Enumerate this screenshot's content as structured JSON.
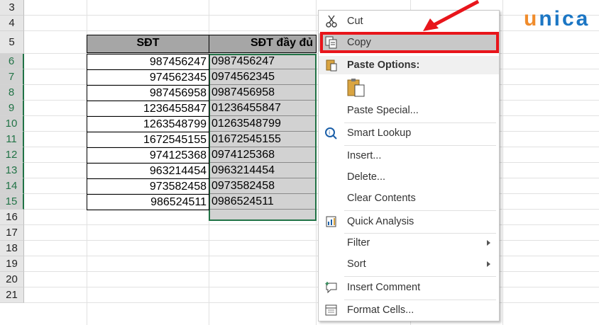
{
  "sheet": {
    "rows": [
      {
        "num": "3"
      },
      {
        "num": "4"
      },
      {
        "num": "5"
      },
      {
        "num": "6"
      },
      {
        "num": "7"
      },
      {
        "num": "8"
      },
      {
        "num": "9"
      },
      {
        "num": "10"
      },
      {
        "num": "11"
      },
      {
        "num": "12"
      },
      {
        "num": "13"
      },
      {
        "num": "14"
      },
      {
        "num": "15"
      },
      {
        "num": "16"
      },
      {
        "num": "17"
      },
      {
        "num": "18"
      },
      {
        "num": "19"
      },
      {
        "num": "20"
      },
      {
        "num": "21"
      }
    ],
    "table": {
      "headers": [
        "SĐT",
        "SĐT đầy đủ"
      ],
      "data": [
        [
          "987456247",
          "0987456247"
        ],
        [
          "974562345",
          "0974562345"
        ],
        [
          "987456958",
          "0987456958"
        ],
        [
          "1236455847",
          "01236455847"
        ],
        [
          "1263548799",
          "01263548799"
        ],
        [
          "1672545155",
          "01672545155"
        ],
        [
          "974125368",
          "0974125368"
        ],
        [
          "963214454",
          "0963214454"
        ],
        [
          "973582458",
          "0973582458"
        ],
        [
          "986524511",
          "0986524511"
        ]
      ]
    }
  },
  "context_menu": {
    "cut": "Cut",
    "copy": "Copy",
    "paste_options": "Paste Options:",
    "paste_special": "Paste Special...",
    "smart_lookup": "Smart Lookup",
    "insert": "Insert...",
    "delete": "Delete...",
    "clear_contents": "Clear Contents",
    "quick_analysis": "Quick Analysis",
    "filter": "Filter",
    "sort": "Sort",
    "insert_comment": "Insert Comment",
    "format_cells": "Format Cells..."
  },
  "logo": {
    "u": "u",
    "rest": "nica"
  },
  "colors": {
    "highlight": "#e8151b",
    "excel_green": "#217346",
    "logo_blue": "#1b76c4",
    "logo_orange": "#f08c2c"
  }
}
